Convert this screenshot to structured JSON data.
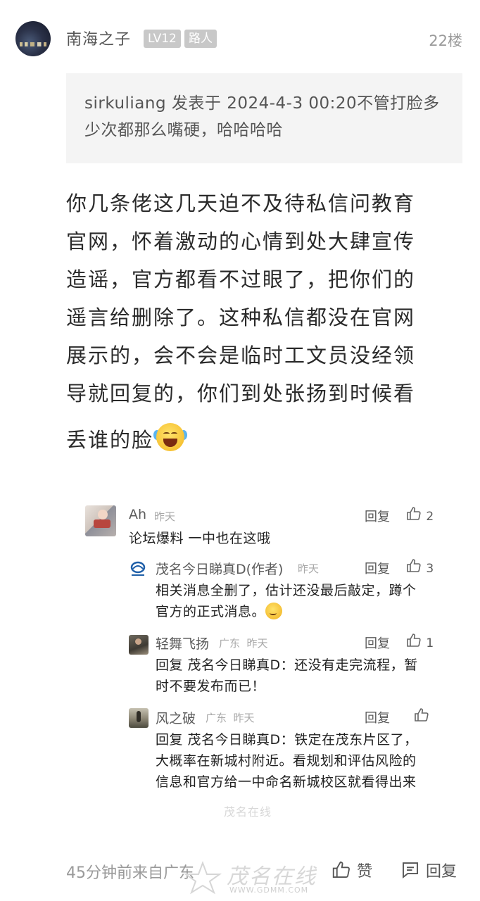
{
  "post": {
    "author": "南海之子",
    "level_badge": "LV12",
    "role_badge": "路人",
    "floor": "22楼",
    "quote": "sirkuliang 发表于 2024-4-3 00:20不管打脸多少次都那么嘴硬，哈哈哈哈",
    "body_lines": [
      "你几条佬这几天迫不及待私信问教育",
      "官网，怀着激动的心情到处大肆宣传",
      "造谣，官方都看不过眼了，把你们的",
      "遥言给删除了。这种私信都没在官网",
      "展示的，会不会是临时工文员没经领",
      "导就回复的，你们到处张扬到时候看",
      "丢谁的脸"
    ],
    "body_emoji": "laughing-crying-emoji"
  },
  "comments": [
    {
      "name": "Ah",
      "meta": "昨天",
      "reply_label": "回复",
      "likes": "2",
      "text": "论坛爆料 一中也在这哦"
    },
    {
      "name": "茂名今日睇真D(作者)",
      "meta": "昨天",
      "reply_label": "回复",
      "likes": "3",
      "text_line1": "相关消息全删了，估计还没最后敲定，蹲个",
      "text_line2": "官方的正式消息。"
    },
    {
      "name": "轻舞飞扬",
      "meta": "广东  昨天",
      "reply_label": "回复",
      "likes": "1",
      "text_line1": "回复 茂名今日睇真D：还没有走完流程，暂",
      "text_line2": "时不要发布而已！"
    },
    {
      "name": "风之破",
      "meta": "广东  昨天",
      "reply_label": "回复",
      "likes": "",
      "text_line1": "回复 茂名今日睇真D：铁定在茂东片区了，",
      "text_line2": "大概率在新城村附近。看规划和评估风险的",
      "text_line3": "信息和官方给一中命名新城校区就看得出来"
    }
  ],
  "footer": {
    "time_location": "45分钟前来自广东",
    "like_label": "赞",
    "reply_label": "回复"
  },
  "watermark": {
    "small_mark": "茂名在线",
    "big_mark": "茂名在线",
    "url": "WWW.GDMM.COM"
  },
  "colors": {
    "badge_bg": "#c8c8c8",
    "quote_bg": "#f4f4f4",
    "meta_gray": "#a8a8a8"
  }
}
